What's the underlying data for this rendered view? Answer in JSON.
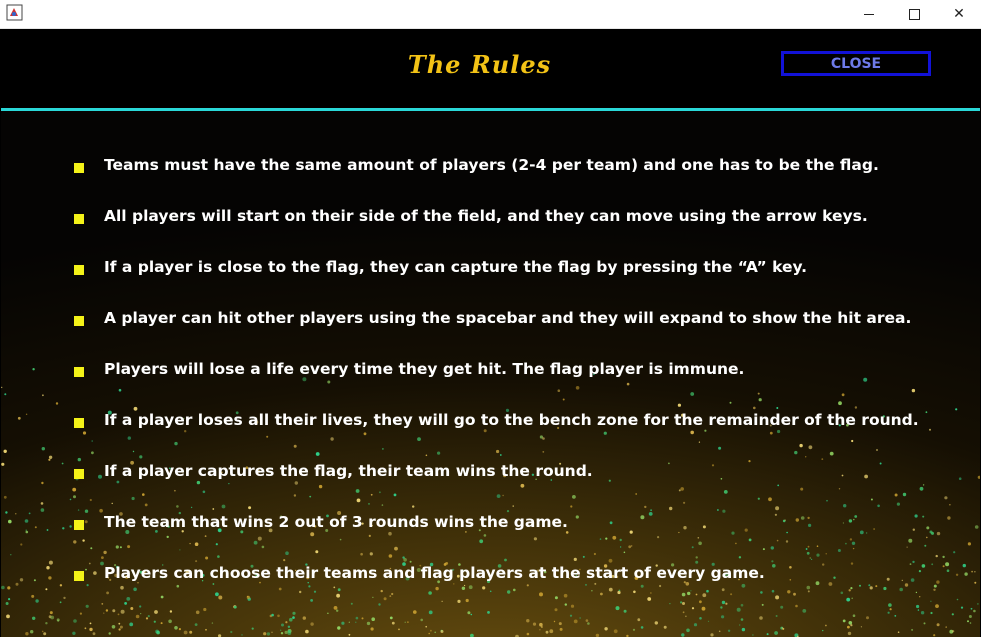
{
  "window": {
    "minimize_icon": "minimize-icon",
    "maximize_icon": "maximize-icon",
    "close_icon": "close-icon",
    "close_glyph": "✕"
  },
  "header": {
    "title": "The Rules",
    "close_label": "CLOSE",
    "title_color": "#f3c316",
    "rule_color": "#2ad8d8",
    "close_border_color": "#1212d8"
  },
  "rules": {
    "bullet_color": "#f4f218",
    "items": [
      "Teams must have the same amount of players (2-4 per team) and one has to be the flag.",
      "All players will start on their side of the field, and they can move using the arrow keys.",
      "If a player is close to the flag, they can capture the flag by pressing the “A” key.",
      "A player can hit other players using the spacebar and they will expand to show the hit area.",
      "Players will lose a life every time they get hit. The flag player is immune.",
      "If a player loses all their lives, they will go to the bench zone for the remainder of the round.",
      "If a player captures the flag, their team wins the round.",
      "The team that wins 2 out of 3 rounds wins the game.",
      "Players can choose their teams and flag players at the start of every game."
    ]
  }
}
